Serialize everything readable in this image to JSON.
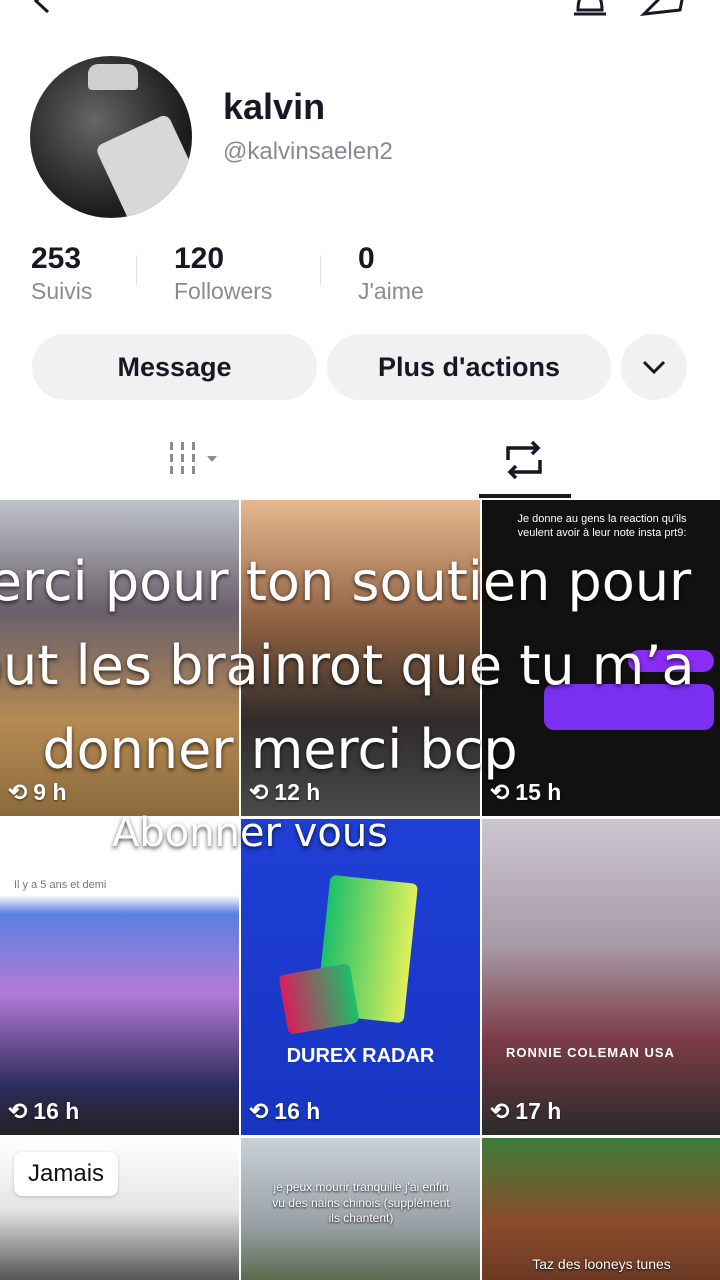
{
  "profile": {
    "name": "kalvin",
    "handle": "@kalvinsaelen2"
  },
  "stats": [
    {
      "value": "253",
      "label": "Suivis"
    },
    {
      "value": "120",
      "label": "Followers"
    },
    {
      "value": "0",
      "label": "J'aime"
    }
  ],
  "actions": {
    "message": "Message",
    "more": "Plus d'actions"
  },
  "posts": [
    {
      "time": "9 h",
      "caption": ""
    },
    {
      "time": "12 h",
      "caption": ""
    },
    {
      "time": "15 h",
      "caption": "Je donne au gens la reaction qu'ils veulent avoir à leur note insta prt9:"
    },
    {
      "time": "16 h",
      "caption": "Il y a 5 ans et demi"
    },
    {
      "time": "16 h",
      "caption": "DUREX RADAR"
    },
    {
      "time": "17 h",
      "caption": "RONNIE COLEMAN USA"
    },
    {
      "time": "",
      "caption": "Jamais"
    },
    {
      "time": "",
      "caption": "je peux mourir tranquille j'ai enfin vu des nains chinois (supplément ils chantent)"
    },
    {
      "time": "",
      "caption": "Taz des looneys tunes"
    }
  ],
  "overlay": {
    "line1": "erci pour ton soutien pour",
    "line2": "out les brainrot que tu m’a",
    "line3": "donner merci bcp",
    "line4": "Abonner vous"
  },
  "colors": {
    "accent": "#161823",
    "muted": "#8a8b91",
    "button": "#f1f1f2"
  }
}
